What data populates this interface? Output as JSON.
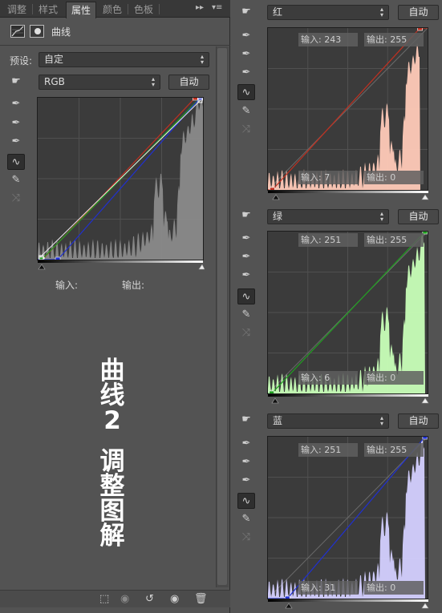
{
  "tabs": [
    "调整",
    "样式",
    "属性",
    "颜色",
    "色板"
  ],
  "active_tab": "属性",
  "tab_controls": {
    "collapse": "▸▸",
    "menu": "▾≡"
  },
  "header": {
    "title": "曲线"
  },
  "preset": {
    "label": "预设:",
    "value": "自定"
  },
  "channel": {
    "value": "RGB"
  },
  "auto_label": "自动",
  "io": {
    "input_label": "输入:",
    "output_label": "输出:"
  },
  "overlay_title": [
    "曲",
    "线",
    "2",
    "调",
    "整",
    "图",
    "解"
  ],
  "tools": [
    "pointer-hand-icon",
    "eyedropper-black-icon",
    "eyedropper-gray-icon",
    "eyedropper-white-icon",
    "curve-point-icon",
    "pencil-icon",
    "smooth-icon"
  ],
  "footer": [
    "clip-to-layer-icon",
    "view-previous-icon",
    "reset-icon",
    "visibility-eye-icon",
    "trash-icon"
  ],
  "right_panels": [
    {
      "channel": "红",
      "auto": "自动",
      "in_top_label": "输入:",
      "in_top": "243",
      "out_top_label": "输出:",
      "out_top": "255",
      "in_bot_label": "输入:",
      "in_bot": "7",
      "out_bot_label": "输出:",
      "out_bot": "0",
      "color": "#ffcab8",
      "line": "#c03020"
    },
    {
      "channel": "绿",
      "auto": "自动",
      "in_top_label": "输入:",
      "in_top": "251",
      "out_top_label": "输出:",
      "out_top": "255",
      "in_bot_label": "输入:",
      "in_bot": "6",
      "out_bot_label": "输出:",
      "out_bot": "0",
      "color": "#c8ffb8",
      "line": "#20a020"
    },
    {
      "channel": "蓝",
      "auto": "自动",
      "in_top_label": "输入:",
      "in_top": "251",
      "out_top_label": "输出:",
      "out_top": "255",
      "in_bot_label": "输入:",
      "in_bot": "31",
      "out_bot_label": "输出:",
      "out_bot": "0",
      "color": "#d4d0ff",
      "line": "#2030d0"
    }
  ],
  "colors": {
    "panel": "#535353",
    "graph_bg": "#3b3b3b",
    "histogram_gray": "#8a8a8a"
  }
}
